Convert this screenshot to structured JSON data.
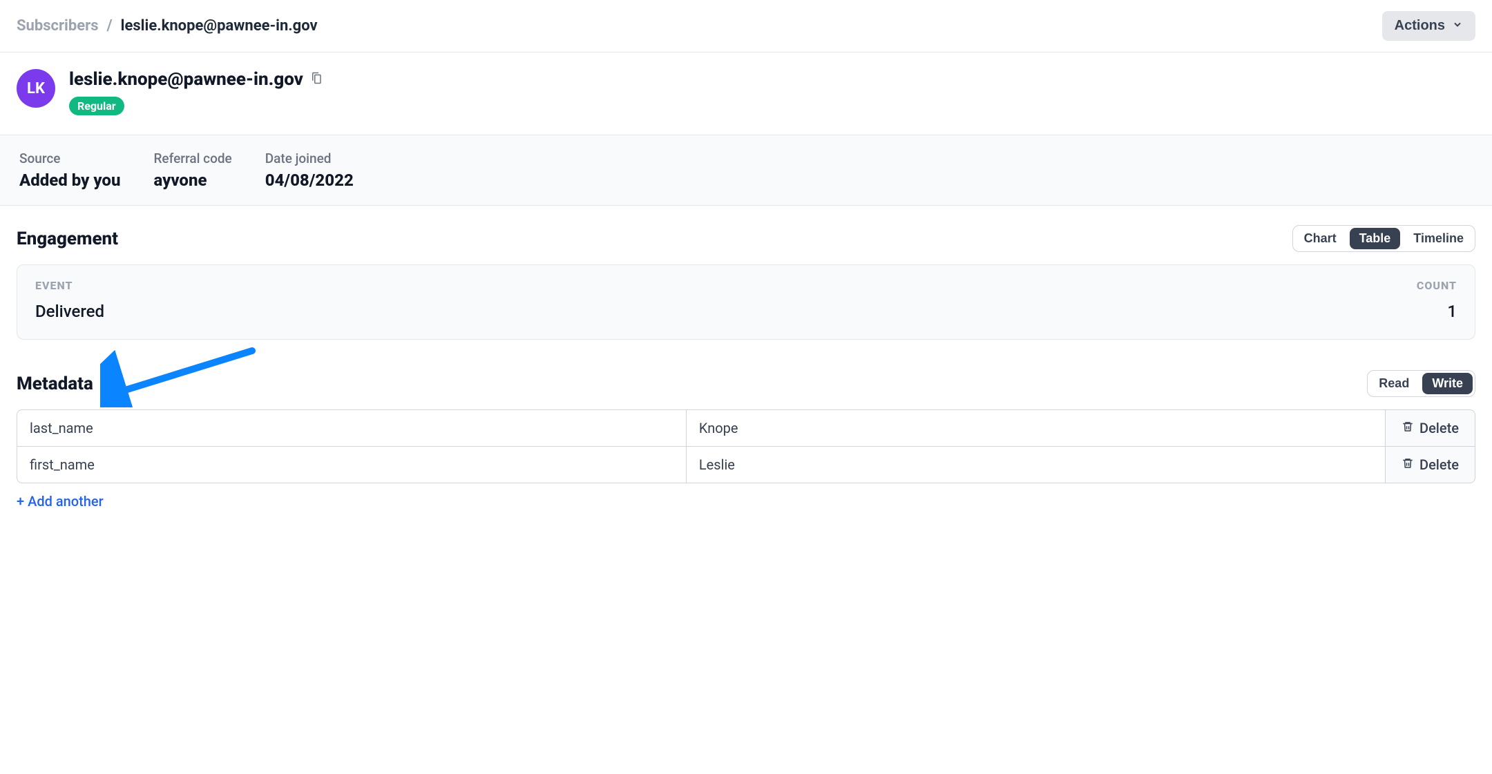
{
  "breadcrumb": {
    "root": "Subscribers",
    "separator": "/",
    "current": "leslie.knope@pawnee-in.gov"
  },
  "actions_label": "Actions",
  "avatar_initials": "LK",
  "page_title": "leslie.knope@pawnee-in.gov",
  "status_badge": "Regular",
  "info": {
    "source_label": "Source",
    "source_value": "Added by you",
    "referral_label": "Referral code",
    "referral_value": "ayvone",
    "joined_label": "Date joined",
    "joined_value": "04/08/2022"
  },
  "engagement": {
    "title": "Engagement",
    "tabs": {
      "chart": "Chart",
      "table": "Table",
      "timeline": "Timeline"
    },
    "header_event": "EVENT",
    "header_count": "COUNT",
    "rows": [
      {
        "event": "Delivered",
        "count": "1"
      }
    ]
  },
  "metadata": {
    "title": "Metadata",
    "tabs": {
      "read": "Read",
      "write": "Write"
    },
    "rows": [
      {
        "key": "last_name",
        "value": "Knope"
      },
      {
        "key": "first_name",
        "value": "Leslie"
      }
    ],
    "delete_label": "Delete",
    "add_another": "+ Add another"
  }
}
